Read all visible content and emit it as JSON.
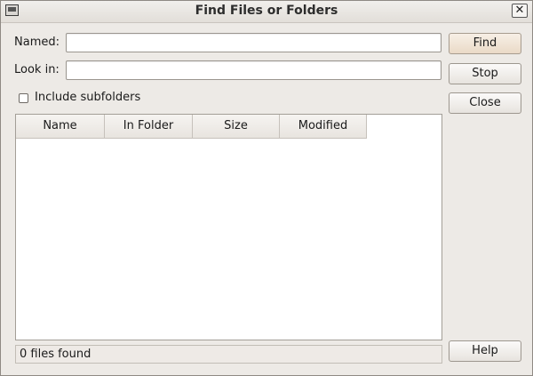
{
  "window": {
    "title": "Find Files or Folders"
  },
  "form": {
    "named_label": "Named:",
    "named_value": "",
    "lookin_label": "Look in:",
    "lookin_value": "",
    "include_subfolders_label": "Include subfolders",
    "include_subfolders_checked": false
  },
  "buttons": {
    "find": "Find",
    "stop": "Stop",
    "close": "Close",
    "help": "Help"
  },
  "results": {
    "columns": [
      "Name",
      "In Folder",
      "Size",
      "Modified"
    ],
    "rows": []
  },
  "status": {
    "text": "0 files found"
  },
  "colors": {
    "window_bg": "#edeae6",
    "default_button": "#eadac7"
  }
}
